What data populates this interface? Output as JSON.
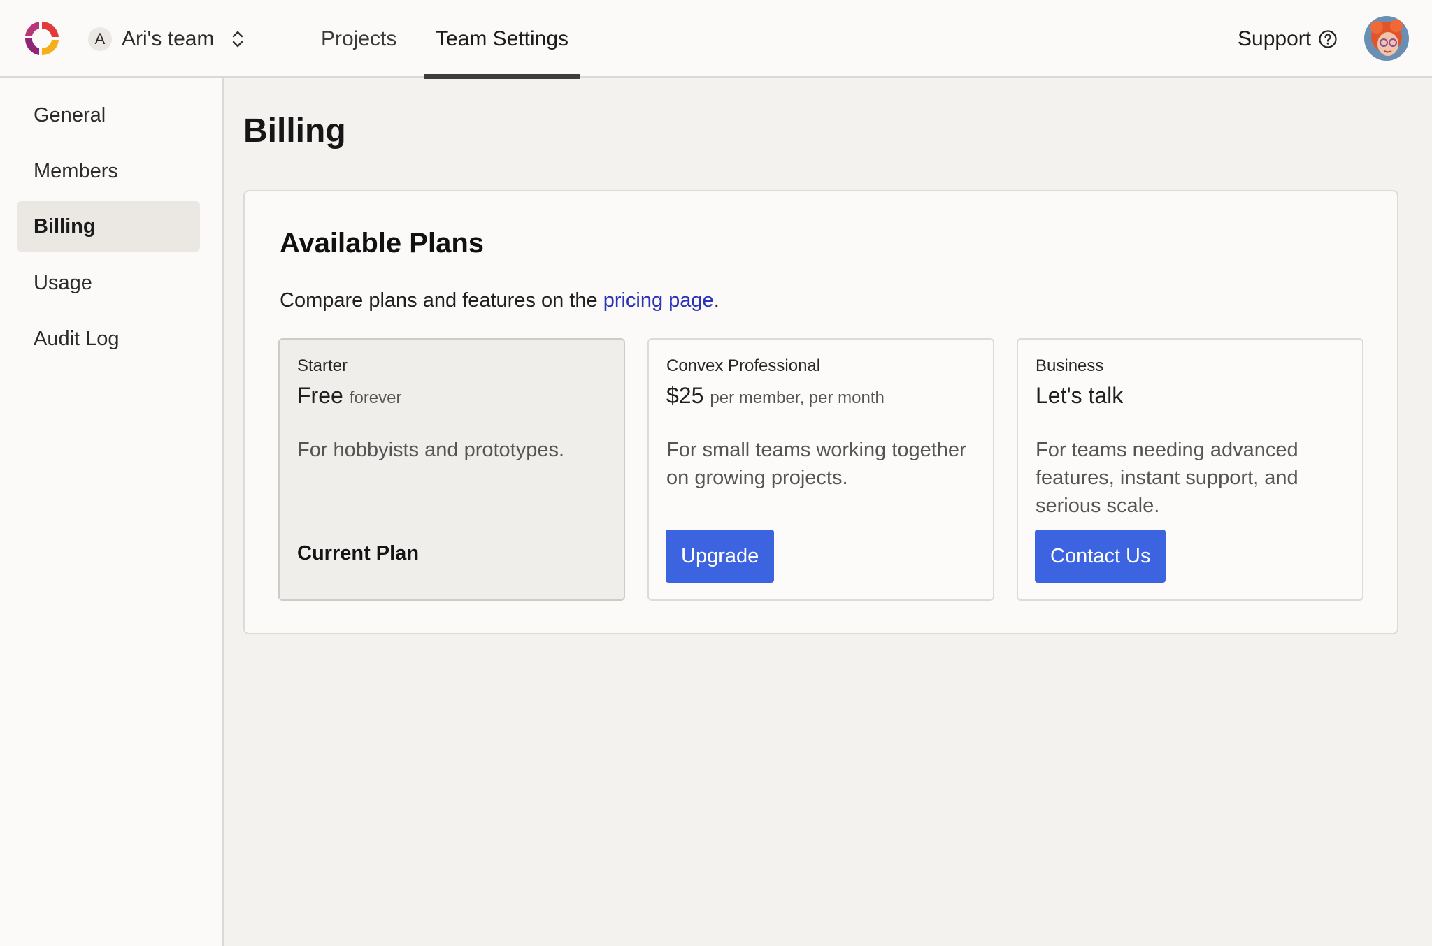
{
  "header": {
    "team_initial": "A",
    "team_name": "Ari's team",
    "nav": {
      "projects": "Projects",
      "team_settings": "Team Settings"
    },
    "support": "Support",
    "active_tab": "Team Settings"
  },
  "sidebar": {
    "items": [
      {
        "label": "General"
      },
      {
        "label": "Members"
      },
      {
        "label": "Billing",
        "active": true
      },
      {
        "label": "Usage"
      },
      {
        "label": "Audit Log"
      }
    ]
  },
  "main": {
    "title": "Billing",
    "available_plans": {
      "heading": "Available Plans",
      "desc_prefix": "Compare plans and features on the ",
      "desc_link": "pricing page",
      "desc_suffix": ".",
      "plans": [
        {
          "name": "Starter",
          "price": "Free",
          "price_note": "forever",
          "description": "For hobbyists and prototypes.",
          "status": "Current Plan"
        },
        {
          "name": "Convex Professional",
          "price": "$25",
          "price_note": "per member, per month",
          "description": "For small teams working together on growing projects.",
          "action": "Upgrade"
        },
        {
          "name": "Business",
          "price": "Let's talk",
          "price_note": "",
          "description": "For teams needing advanced features, instant support, and serious scale.",
          "action": "Contact Us"
        }
      ]
    }
  },
  "colors": {
    "accent_button": "#3c64e0",
    "link": "#2a33b8",
    "background": "#f4f2ef"
  }
}
